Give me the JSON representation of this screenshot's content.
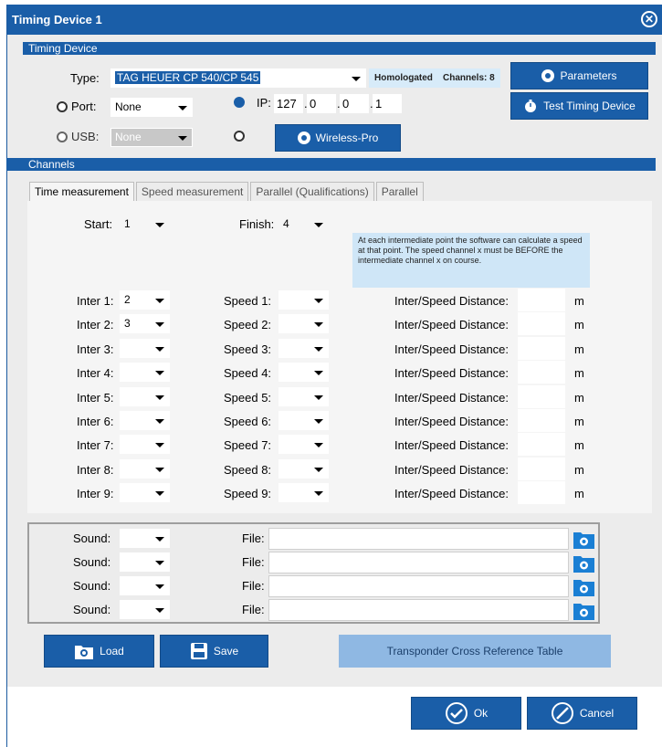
{
  "window": {
    "title": "Timing Device 1",
    "close_icon": "close-circle-icon"
  },
  "timing_device": {
    "section_title": "Timing Device",
    "type_label": "Type:",
    "type_value": "TAG HEUER CP 540/CP 545",
    "homologated": "Homologated",
    "channels": "Channels: 8",
    "parameters_label": "Parameters",
    "test_label": "Test Timing Device",
    "port_label": "Port:",
    "port_value": "None",
    "usb_label": "USB:",
    "usb_value": "None",
    "ip_label": "IP:",
    "ip": [
      "127",
      "0",
      "0",
      "1"
    ],
    "ip_dot": ".",
    "wireless_label": "Wireless-Pro"
  },
  "channels": {
    "section_title": "Channels",
    "tabs": [
      "Time measurement",
      "Speed measurement",
      "Parallel (Qualifications)",
      "Parallel"
    ],
    "start_label": "Start:",
    "start_value": "1",
    "finish_label": "Finish:",
    "finish_value": "4",
    "info_text": "At each intermediate point the software can calculate a speed at that point. The speed channel x must be BEFORE the intermediate channel x on course.",
    "distance_label": "Inter/Speed Distance:",
    "unit": "m",
    "rows": [
      {
        "inter_label": "Inter 1:",
        "inter_value": "2",
        "speed_label": "Speed 1:"
      },
      {
        "inter_label": "Inter 2:",
        "inter_value": "3",
        "speed_label": "Speed 2:"
      },
      {
        "inter_label": "Inter 3:",
        "inter_value": "",
        "speed_label": "Speed 3:"
      },
      {
        "inter_label": "Inter 4:",
        "inter_value": "",
        "speed_label": "Speed 4:"
      },
      {
        "inter_label": "Inter 5:",
        "inter_value": "",
        "speed_label": "Speed 5:"
      },
      {
        "inter_label": "Inter 6:",
        "inter_value": "",
        "speed_label": "Speed 6:"
      },
      {
        "inter_label": "Inter 7:",
        "inter_value": "",
        "speed_label": "Speed 7:"
      },
      {
        "inter_label": "Inter 8:",
        "inter_value": "",
        "speed_label": "Speed 8:"
      },
      {
        "inter_label": "Inter 9:",
        "inter_value": "",
        "speed_label": "Speed 9:"
      }
    ]
  },
  "sounds": {
    "sound_label": "Sound:",
    "file_label": "File:",
    "rows": 4
  },
  "actions": {
    "load_label": "Load",
    "save_label": "Save",
    "transponder_label": "Transponder Cross Reference Table",
    "ok_label": "Ok",
    "cancel_label": "Cancel"
  },
  "colors": {
    "primary": "#1a5ea8",
    "info_bg": "#cfe6f7",
    "transponder_bg": "#8fb8e3"
  }
}
